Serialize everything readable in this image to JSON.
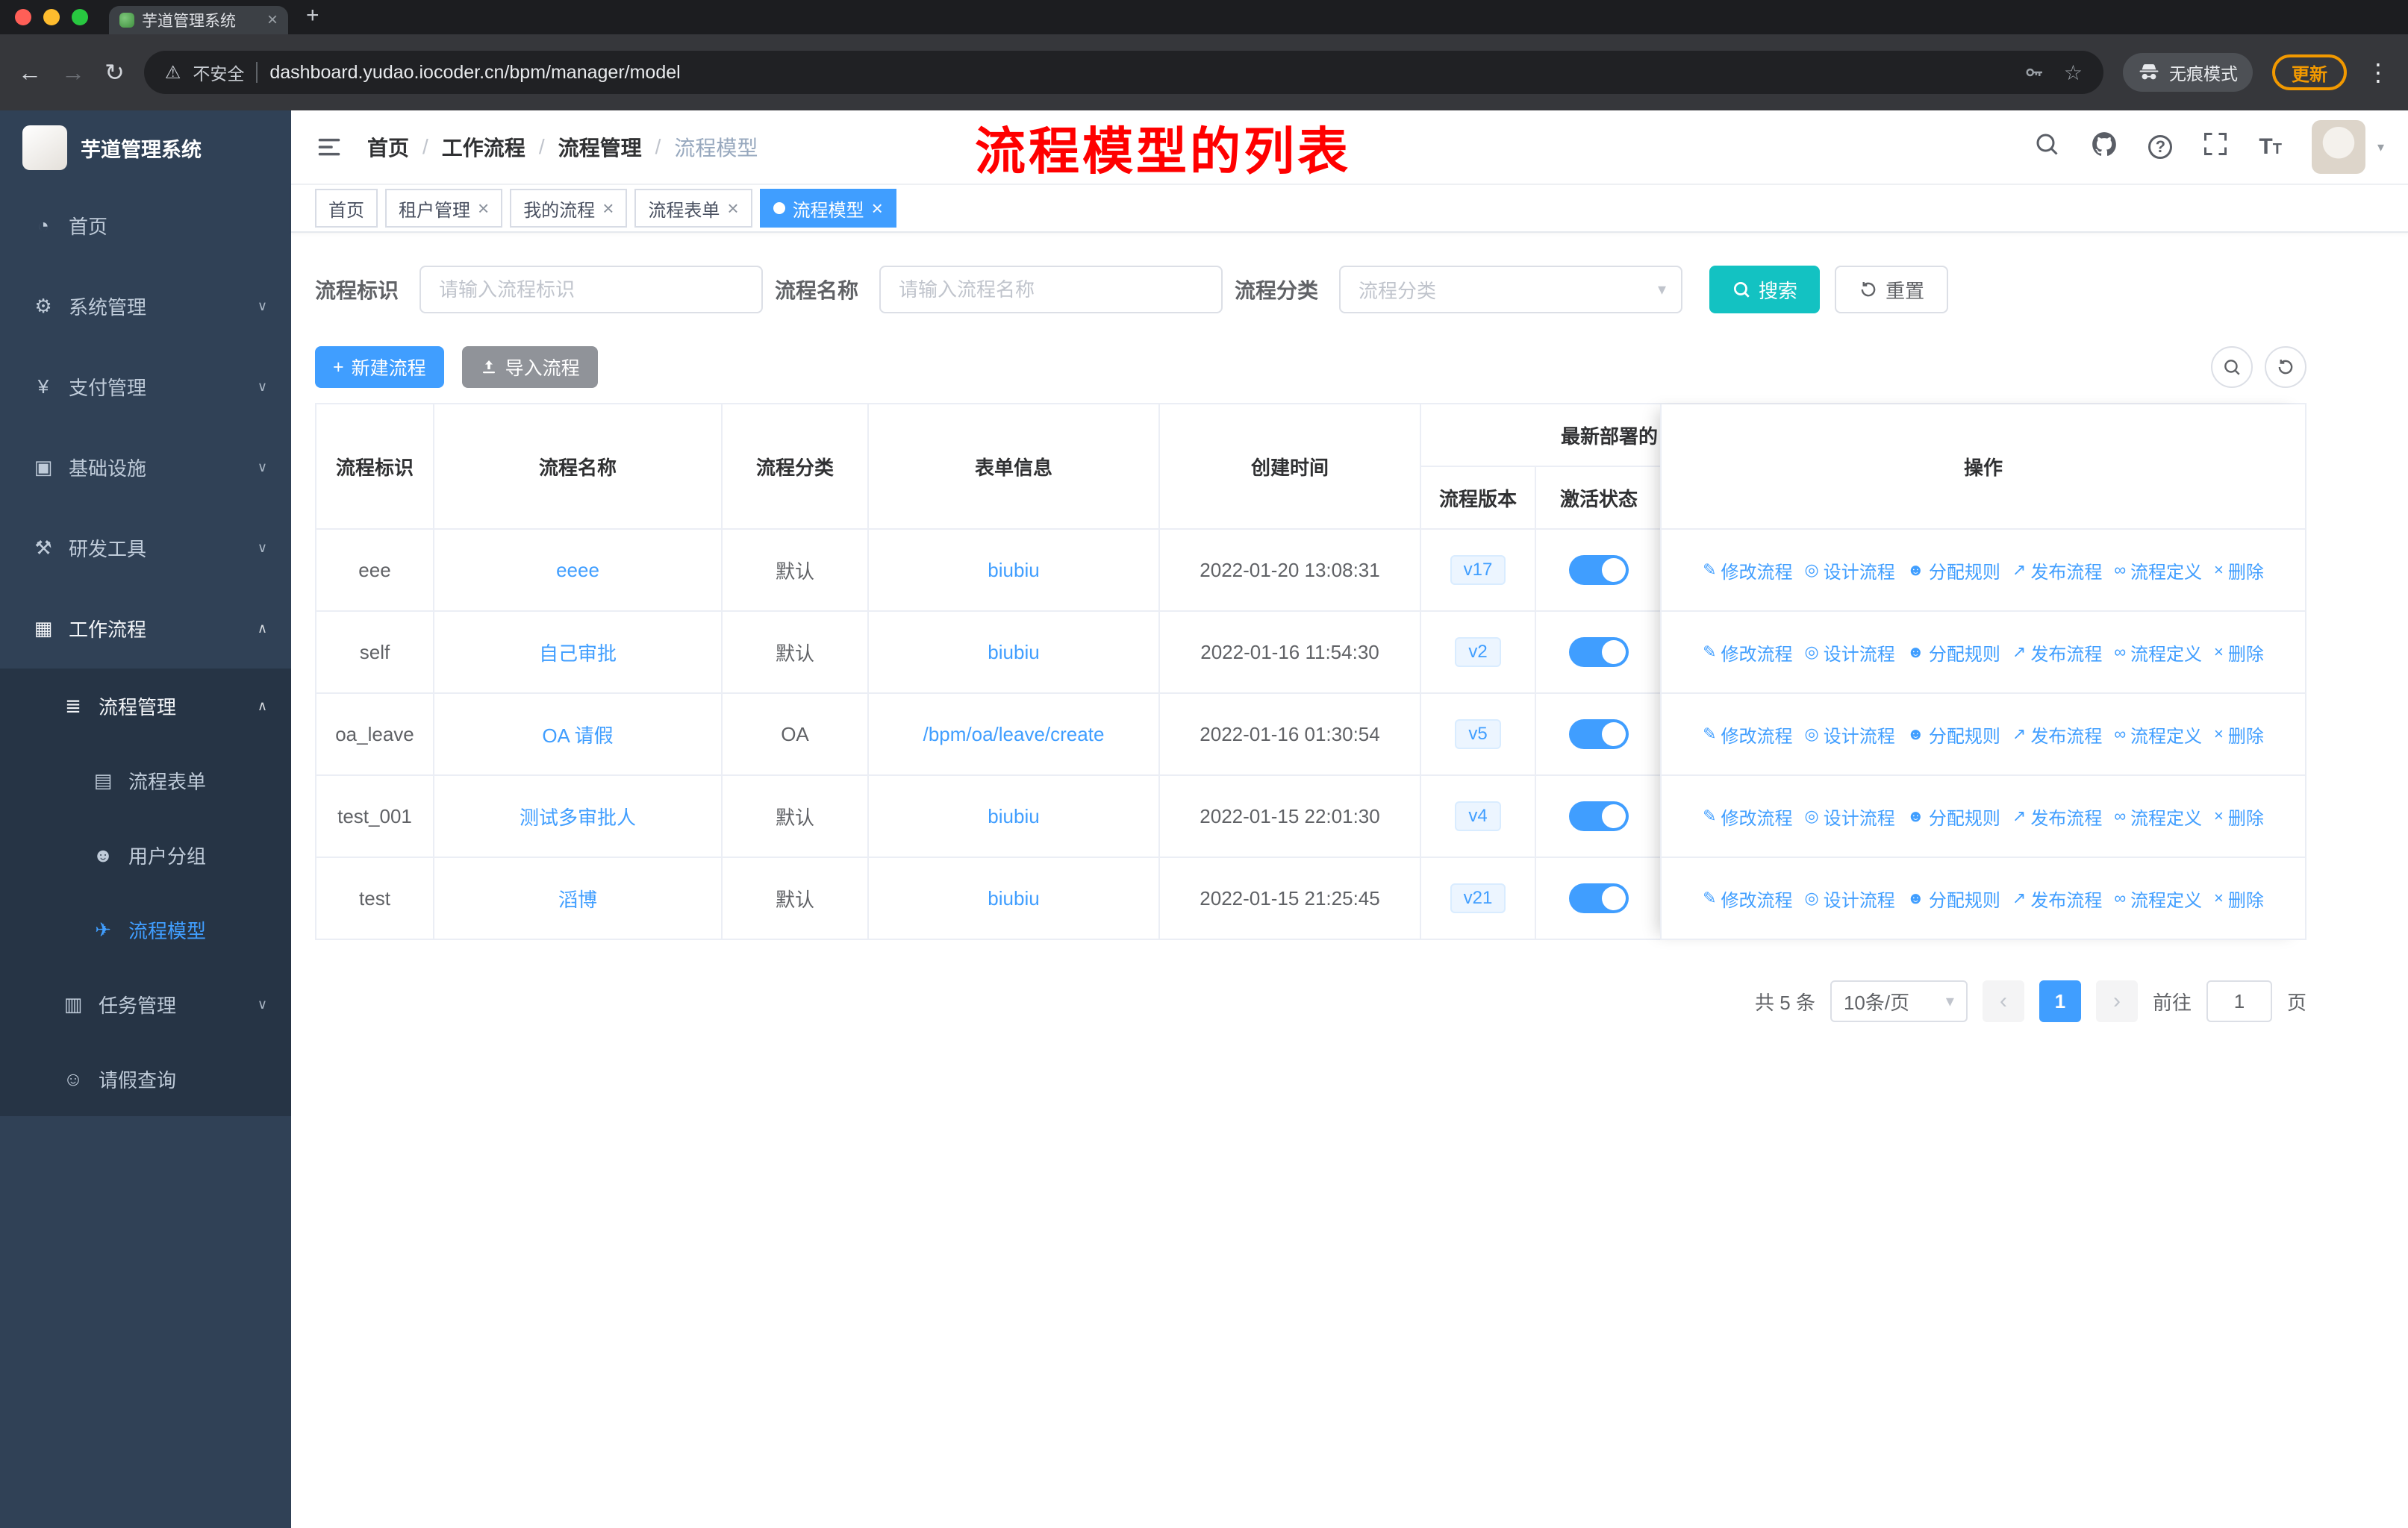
{
  "browser": {
    "tab_title": "芋道管理系统",
    "security_label": "不安全",
    "url": "dashboard.yudao.iocoder.cn/bpm/manager/model",
    "incognito_label": "无痕模式",
    "update_label": "更新"
  },
  "sidebar": {
    "logo_text": "芋道管理系统",
    "menu": [
      {
        "key": "home",
        "label": "首页",
        "icon": "dashboard-icon",
        "level": 1
      },
      {
        "key": "system",
        "label": "系统管理",
        "icon": "gear-icon",
        "level": 1,
        "arrow": "down"
      },
      {
        "key": "payment",
        "label": "支付管理",
        "icon": "payment-icon",
        "level": 1,
        "arrow": "down"
      },
      {
        "key": "infrastructure",
        "label": "基础设施",
        "icon": "infrastructure-icon",
        "level": 1,
        "arrow": "down"
      },
      {
        "key": "devtools",
        "label": "研发工具",
        "icon": "devtools-icon",
        "level": 1,
        "arrow": "down"
      },
      {
        "key": "workflow",
        "label": "工作流程",
        "icon": "workflow-icon",
        "level": 1,
        "arrow": "up",
        "open": true
      },
      {
        "key": "process-manage",
        "label": "流程管理",
        "icon": "process-manage-icon",
        "level": 2,
        "arrow": "up",
        "open": true
      },
      {
        "key": "process-form",
        "label": "流程表单",
        "icon": "form-icon",
        "level": 3
      },
      {
        "key": "user-group",
        "label": "用户分组",
        "icon": "user-group-icon",
        "level": 3
      },
      {
        "key": "process-model",
        "label": "流程模型",
        "icon": "paper-plane-icon",
        "level": 3,
        "active": true
      },
      {
        "key": "task-manage",
        "label": "任务管理",
        "icon": "task-icon",
        "level": 2,
        "arrow": "down"
      },
      {
        "key": "leave-query",
        "label": "请假查询",
        "icon": "user-icon",
        "level": 2
      }
    ]
  },
  "header": {
    "breadcrumb": [
      "首页",
      "工作流程",
      "流程管理",
      "流程模型"
    ],
    "annotation": "流程模型的列表"
  },
  "tags": [
    {
      "label": "首页",
      "closable": false,
      "active": false
    },
    {
      "label": "租户管理",
      "closable": true,
      "active": false
    },
    {
      "label": "我的流程",
      "closable": true,
      "active": false
    },
    {
      "label": "流程表单",
      "closable": true,
      "active": false
    },
    {
      "label": "流程模型",
      "closable": true,
      "active": true
    }
  ],
  "filters": {
    "fields": [
      {
        "label": "流程标识",
        "placeholder": "请输入流程标识",
        "type": "input"
      },
      {
        "label": "流程名称",
        "placeholder": "请输入流程名称",
        "type": "input"
      },
      {
        "label": "流程分类",
        "placeholder": "流程分类",
        "type": "select"
      }
    ],
    "search_label": "搜索",
    "reset_label": "重置"
  },
  "toolbar": {
    "create_label": "新建流程",
    "import_label": "导入流程"
  },
  "table": {
    "columns": [
      "流程标识",
      "流程名称",
      "流程分类",
      "表单信息",
      "创建时间"
    ],
    "group_header": "最新部署的",
    "sub_columns": [
      "流程版本",
      "激活状态"
    ],
    "ops_header": "操作",
    "actions": [
      {
        "label": "修改流程",
        "icon": "edit-icon"
      },
      {
        "label": "设计流程",
        "icon": "design-icon"
      },
      {
        "label": "分配规则",
        "icon": "assign-user-icon"
      },
      {
        "label": "发布流程",
        "icon": "publish-icon"
      },
      {
        "label": "流程定义",
        "icon": "definition-icon"
      },
      {
        "label": "删除",
        "icon": "delete-icon"
      }
    ],
    "rows": [
      {
        "key": "eee",
        "name": "eeee",
        "category": "默认",
        "form": "biubiu",
        "created": "2022-01-20 13:08:31",
        "version": "v17",
        "active": true
      },
      {
        "key": "self",
        "name": "自己审批",
        "category": "默认",
        "form": "biubiu",
        "created": "2022-01-16 11:54:30",
        "version": "v2",
        "active": true
      },
      {
        "key": "oa_leave",
        "name": "OA 请假",
        "category": "OA",
        "form": "/bpm/oa/leave/create",
        "created": "2022-01-16 01:30:54",
        "version": "v5",
        "active": true
      },
      {
        "key": "test_001",
        "name": "测试多审批人",
        "category": "默认",
        "form": "biubiu",
        "created": "2022-01-15 22:01:30",
        "version": "v4",
        "active": true
      },
      {
        "key": "test",
        "name": "滔博",
        "category": "默认",
        "form": "biubiu",
        "created": "2022-01-15 21:25:45",
        "version": "v21",
        "active": true
      }
    ]
  },
  "pagination": {
    "total_label": "共 5 条",
    "page_size": "10条/页",
    "prev_label": "‹",
    "current_page": "1",
    "next_label": "›",
    "goto_label": "前往",
    "goto_value": "1",
    "page_unit": "页"
  },
  "colors": {
    "primary": "#409eff",
    "search_button": "#13c2c2",
    "annotation_red": "#ff0000",
    "sidebar_bg": "#304156",
    "sidebar_sub_bg": "#263445",
    "version_tag_bg": "#ecf5ff"
  }
}
